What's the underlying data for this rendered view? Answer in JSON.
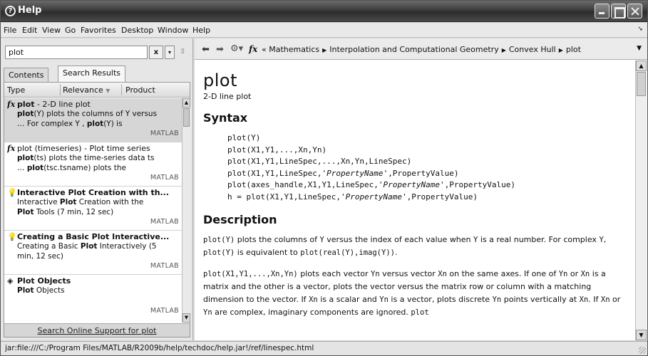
{
  "window": {
    "title": "Help"
  },
  "menu": [
    "File",
    "Edit",
    "View",
    "Go",
    "Favorites",
    "Desktop",
    "Window",
    "Help"
  ],
  "search": {
    "value": "plot",
    "clear_label": "x",
    "dropdown_label": "▾"
  },
  "tabs": {
    "contents": "Contents",
    "search_results": "Search Results"
  },
  "columns": {
    "type": "Type",
    "relevance": "Relevance",
    "relevance_sort": "▼",
    "product": "Product"
  },
  "results": [
    {
      "icon": "fx",
      "title_bold": "plot",
      "title_rest": " - 2-D line plot",
      "desc_line1_bold": "plot",
      "desc_line1": "(Y) plots the columns of Y versus",
      "desc_line2_pre": "… For complex Y , ",
      "desc_line2_bold": "plot",
      "desc_line2_post": "(Y) is",
      "product": "MATLAB"
    },
    {
      "icon": "fx",
      "title_bold": "plot (timeseries)",
      "title_rest": " - Plot time series",
      "desc_line1_bold": "plot",
      "desc_line1": "(ts) plots the time-series data ts",
      "desc_line2_pre": "… ",
      "desc_line2_bold": "plot",
      "desc_line2_post": "(tsc.tsname) plots the",
      "product": "MATLAB"
    },
    {
      "icon": "bulb",
      "title": "Interactive Plot Creation with th...",
      "desc_line1_pre": "Interactive ",
      "desc_line1_bold": "Plot",
      "desc_line1": " Creation with the",
      "desc_line2_bold": "Plot",
      "desc_line2_post": " Tools (7 min, 12 sec)",
      "product": "MATLAB"
    },
    {
      "icon": "bulb",
      "title": "Creating a Basic Plot Interactive...",
      "desc_line1_pre": "Creating a Basic ",
      "desc_line1_bold": "Plot",
      "desc_line1": " Interactively (5",
      "desc_line2_post": "min, 12 sec)",
      "product": "MATLAB"
    },
    {
      "icon": "objects",
      "title": "Plot Objects",
      "desc_line1_bold": "Plot",
      "desc_line1": " Objects",
      "product": "MATLAB"
    }
  ],
  "online_link": "Search Online Support for plot",
  "breadcrumb": {
    "prefix": "«",
    "items": [
      "Mathematics",
      "Interpolation and Computational Geometry",
      "Convex Hull",
      "plot"
    ]
  },
  "doc": {
    "title": "plot",
    "subtitle": "2-D line plot",
    "syntax_heading": "Syntax",
    "syntax": [
      "plot(Y)",
      "plot(X1,Y1,...,Xn,Yn)",
      "plot(X1,Y1,LineSpec,...,Xn,Yn,LineSpec)",
      "plot(X1,Y1,LineSpec,'PropertyName',PropertyValue)",
      "plot(axes_handle,X1,Y1,LineSpec,'PropertyName',PropertyValue)",
      "h = plot(X1,Y1,LineSpec,'PropertyName',PropertyValue)"
    ],
    "description_heading": "Description",
    "para1": {
      "c1": "plot(Y)",
      "t1": " plots the columns of ",
      "c2": "Y",
      "t2": " versus the index of each value when ",
      "c3": "Y",
      "t3": " is a real number. For complex ",
      "c4": "Y",
      "t4": ", ",
      "c5": "plot(Y)",
      "t5": " is equivalent to ",
      "c6": "plot(real(Y),imag(Y))",
      "t6": "."
    },
    "para2": {
      "c1": "plot(X1,Y1,...,Xn,Yn)",
      "t1": " plots each vector ",
      "c2": "Yn",
      "t2": " versus vector ",
      "c3": "Xn",
      "t3": " on the same axes. If one of ",
      "c4": "Yn",
      "t4": " or ",
      "c5": "Xn",
      "t5": " is a matrix and the other is a vector, plots the vector versus the matrix row or column with a matching dimension to the vector. If ",
      "c6": "Xn",
      "t6": " is a scalar and ",
      "c7": "Yn",
      "t7": " is a vector, plots discrete ",
      "c8": "Yn",
      "t8": " points vertically at ",
      "c9": "Xn",
      "t9": ". If ",
      "c10": "Xn",
      "t10": " or ",
      "c11": "Yn",
      "t11": " are complex, imaginary components are ignored. ",
      "c12": "plot"
    }
  },
  "status": "jar:file:///C:/Program Files/MATLAB/R2009b/help/techdoc/help.jar!/ref/linespec.html"
}
